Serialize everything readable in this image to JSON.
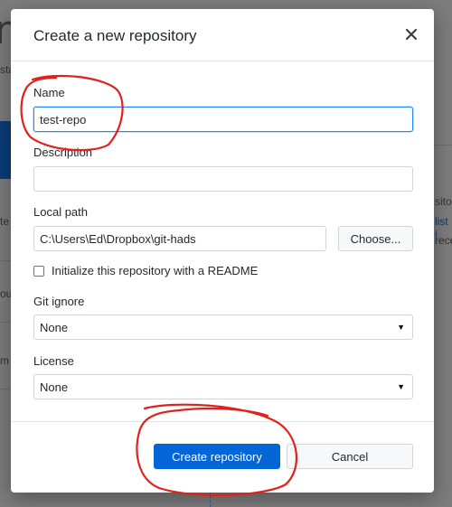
{
  "background": {
    "big_letter": "r",
    "fragments": [
      "sta",
      "te",
      "ou",
      "m",
      "sito",
      "list i",
      "rece"
    ]
  },
  "dialog": {
    "title": "Create a new repository",
    "close_icon": "close-icon",
    "name": {
      "label": "Name",
      "value": "test-repo"
    },
    "description": {
      "label": "Description",
      "value": ""
    },
    "local_path": {
      "label": "Local path",
      "value": "C:\\Users\\Ed\\Dropbox\\git-hads",
      "choose_label": "Choose..."
    },
    "readme": {
      "label": "Initialize this repository with a README",
      "checked": false
    },
    "git_ignore": {
      "label": "Git ignore",
      "selected": "None"
    },
    "license": {
      "label": "License",
      "selected": "None"
    },
    "create_label": "Create repository",
    "cancel_label": "Cancel"
  },
  "colors": {
    "primary": "#0366d6",
    "focus": "#2188ff",
    "annotation": "#e0211d"
  }
}
